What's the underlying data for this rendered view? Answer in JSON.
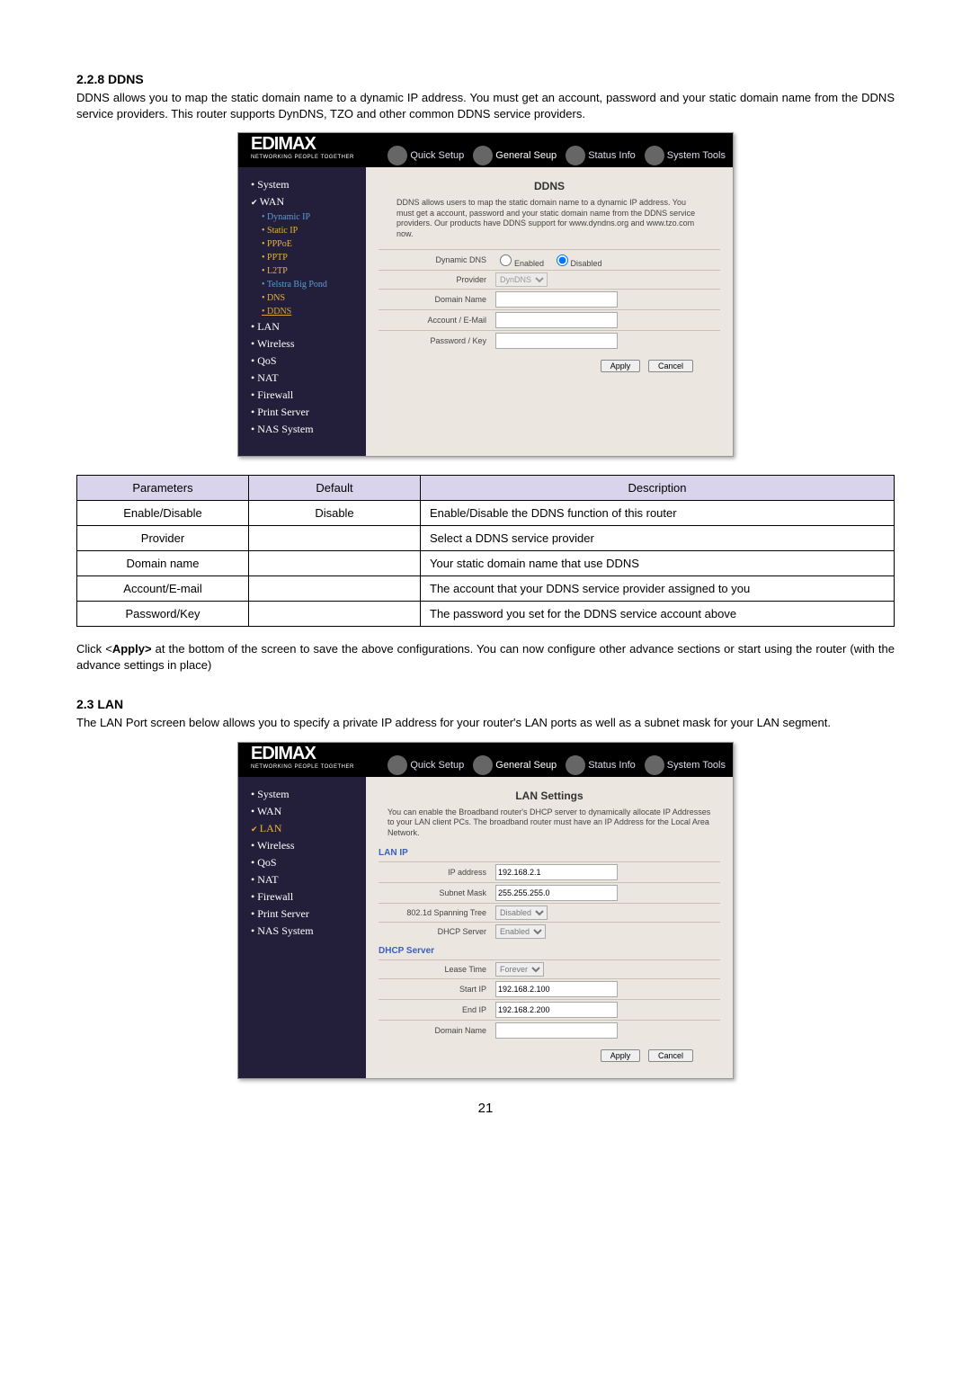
{
  "sections": {
    "ddns": {
      "heading": "2.2.8 DDNS",
      "intro": "DDNS allows you to map the static domain name to a dynamic IP address. You must get an account, password and your static domain name from the DDNS service providers. This router supports DynDNS, TZO and other common DDNS service providers.",
      "apply_note_prefix": "Click <",
      "apply_note_bold": "Apply>",
      "apply_note_suffix": " at the bottom of the screen to save the above configurations. You can now configure other advance sections or start using the router (with the advance settings in place)"
    },
    "lan": {
      "heading": "2.3 LAN",
      "intro": "The LAN Port screen below allows you to specify a private IP address for your router's LAN ports as well as a subnet mask for your LAN segment."
    }
  },
  "router_tabs": {
    "quick": "Quick Setup",
    "general": "General Seup",
    "status": "Status Info",
    "tools": "System Tools"
  },
  "brand": {
    "name": "EDIMAX",
    "tag": "NETWORKING PEOPLE TOGETHER"
  },
  "ddns_panel": {
    "sidebar": {
      "system": "System",
      "wan": "WAN",
      "wan_sub": [
        "Dynamic IP",
        "Static IP",
        "PPPoE",
        "PPTP",
        "L2TP",
        "Telstra Big Pond",
        "DNS",
        "DDNS"
      ],
      "lan": "LAN",
      "wireless": "Wireless",
      "qos": "QoS",
      "nat": "NAT",
      "firewall": "Firewall",
      "print": "Print Server",
      "nas": "NAS System"
    },
    "title": "DDNS",
    "intro": "DDNS allows users to map the static domain name to a dynamic IP address. You must get a account, password and your static domain name from the DDNS service providers. Our products have DDNS support for www.dyndns.org and www.tzo.com now.",
    "rows": {
      "dynamic_dns": "Dynamic DNS",
      "enabled": "Enabled",
      "disabled": "Disabled",
      "provider": "Provider",
      "provider_value": "DynDNS",
      "domain_name": "Domain Name",
      "account": "Account / E-Mail",
      "password": "Password / Key"
    },
    "buttons": {
      "apply": "Apply",
      "cancel": "Cancel"
    }
  },
  "lan_panel": {
    "sidebar": {
      "system": "System",
      "wan": "WAN",
      "lan": "LAN",
      "wireless": "Wireless",
      "qos": "QoS",
      "nat": "NAT",
      "firewall": "Firewall",
      "print": "Print Server",
      "nas": "NAS System"
    },
    "title": "LAN Settings",
    "intro": "You can enable the Broadband router's DHCP server to dynamically allocate IP Addresses to your LAN client PCs. The broadband router must have an IP Address for the Local Area Network.",
    "section1": "LAN IP",
    "section2": "DHCP Server",
    "rows": {
      "ip_address_l": "IP address",
      "ip_address_v": "192.168.2.1",
      "subnet_l": "Subnet Mask",
      "subnet_v": "255.255.255.0",
      "spanning_l": "802.1d Spanning Tree",
      "spanning_v": "Disabled",
      "dhcp_l": "DHCP Server",
      "dhcp_v": "Enabled",
      "lease_l": "Lease Time",
      "lease_v": "Forever",
      "start_l": "Start IP",
      "start_v": "192.168.2.100",
      "end_l": "End IP",
      "end_v": "192.168.2.200",
      "domain_l": "Domain Name"
    },
    "buttons": {
      "apply": "Apply",
      "cancel": "Cancel"
    }
  },
  "param_table": {
    "headers": {
      "param": "Parameters",
      "def": "Default",
      "desc": "Description"
    },
    "rows": [
      {
        "param": "Enable/Disable",
        "def": "Disable",
        "desc": "Enable/Disable the DDNS function of this router"
      },
      {
        "param": "Provider",
        "def": "",
        "desc": "Select a DDNS service provider"
      },
      {
        "param": "Domain name",
        "def": "",
        "desc": "Your static domain name that use DDNS"
      },
      {
        "param": "Account/E-mail",
        "def": "",
        "desc": "The account that your DDNS service provider assigned to you"
      },
      {
        "param": "Password/Key",
        "def": "",
        "desc": "The password you set for the DDNS service account above"
      }
    ]
  },
  "page_number": "21"
}
